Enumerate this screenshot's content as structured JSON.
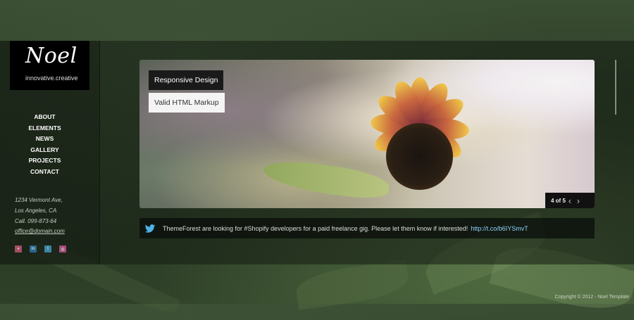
{
  "logo": {
    "name": "Noel",
    "tagline": "innovative.creative"
  },
  "nav": {
    "items": [
      "ABOUT",
      "ELEMENTS",
      "NEWS",
      "GALLERY",
      "PROJECTS",
      "CONTACT"
    ],
    "active": "ABOUT"
  },
  "address": {
    "street": "1234 Vermont Ave,",
    "city": "Los Angeles, CA",
    "phone": "Call. 099-873-64",
    "email": "office@domain.com"
  },
  "socials": [
    {
      "icon": "flickr-icon",
      "color": "#d45d7a"
    },
    {
      "icon": "linkedin-icon",
      "color": "#2f7db7"
    },
    {
      "icon": "twitter-icon",
      "color": "#45a4d6"
    },
    {
      "icon": "dribbble-icon",
      "color": "#d8589a"
    }
  ],
  "slider": {
    "caption_1": "Responsive Design",
    "caption_2": "Valid HTML Markup",
    "counter": "4 of 5",
    "prev_icon": "chevron-left-icon",
    "next_icon": "chevron-right-icon"
  },
  "tweet": {
    "text": "ThemeForest are looking for #Shopify developers for a paid freelance gig. Please let them know if interested!",
    "link": "http://t.co/b6IYSmvT"
  },
  "footer": {
    "copyright": "Copyright © 2012 - Noel Template"
  }
}
